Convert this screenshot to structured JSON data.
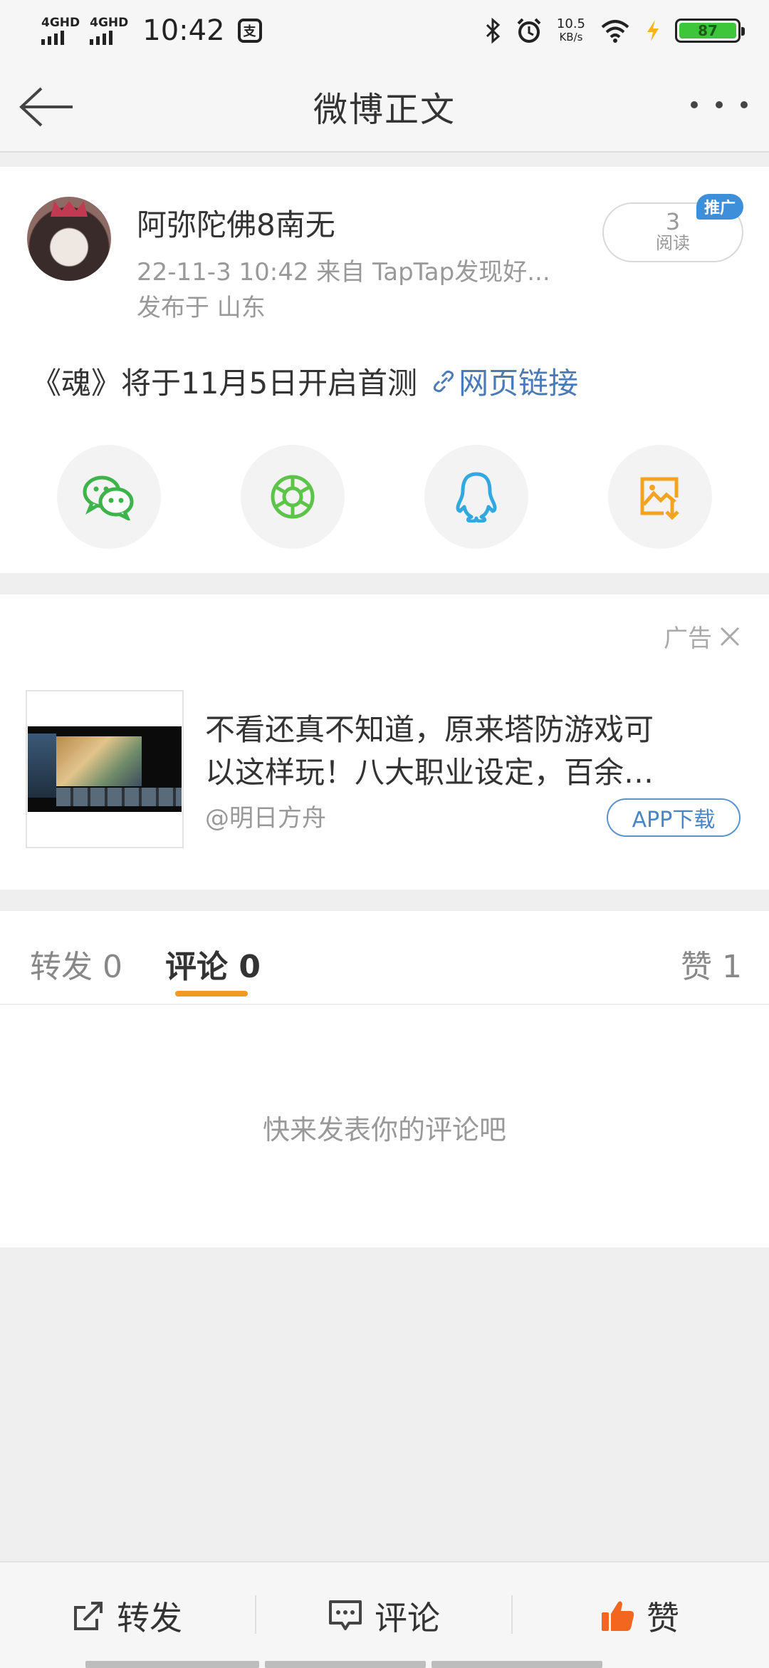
{
  "status_bar": {
    "signal1": "4GHD",
    "signal2": "4GHD",
    "time": "10:42",
    "pay_icon_char": "支",
    "speed_value": "10.5",
    "speed_unit": "KB/s",
    "battery": "87",
    "icons": [
      "bluetooth-icon",
      "alarm-icon",
      "wifi-icon",
      "charging-icon"
    ]
  },
  "nav": {
    "title": "微博正文",
    "back_icon": "back-arrow-icon",
    "more_icon": "more-dots-icon"
  },
  "post": {
    "username": "阿弥陀佛8南无",
    "meta": "22-11-3 10:42   来自 TapTap发现好...",
    "location": "发布于 山东",
    "read_count": "3",
    "read_label": "阅读",
    "promo_tag": "推广",
    "text": "《魂》将于11月5日开启首测",
    "link_label": "网页链接",
    "share_icons": [
      "wechat-icon",
      "moments-icon",
      "qq-icon",
      "save-image-icon"
    ]
  },
  "ad": {
    "label": "广告",
    "title_line1": "不看还真不知道，原来塔防游戏可",
    "title_line2": "以这样玩！八大职业设定，百余…",
    "source": "@明日方舟",
    "download_label": "APP下载"
  },
  "tabs": {
    "repost": "转发 0",
    "comment": "评论 0",
    "like": "赞 1",
    "empty_text": "快来发表你的评论吧"
  },
  "bottom_bar": {
    "repost": "转发",
    "comment": "评论",
    "like": "赞"
  },
  "colors": {
    "accent_orange": "#f29a1f",
    "link_blue": "#4a7bb7",
    "promo_blue": "#3d8fd9",
    "wechat_green": "#3cb44a",
    "qq_blue": "#32a8e0",
    "save_orange": "#f4a321"
  }
}
